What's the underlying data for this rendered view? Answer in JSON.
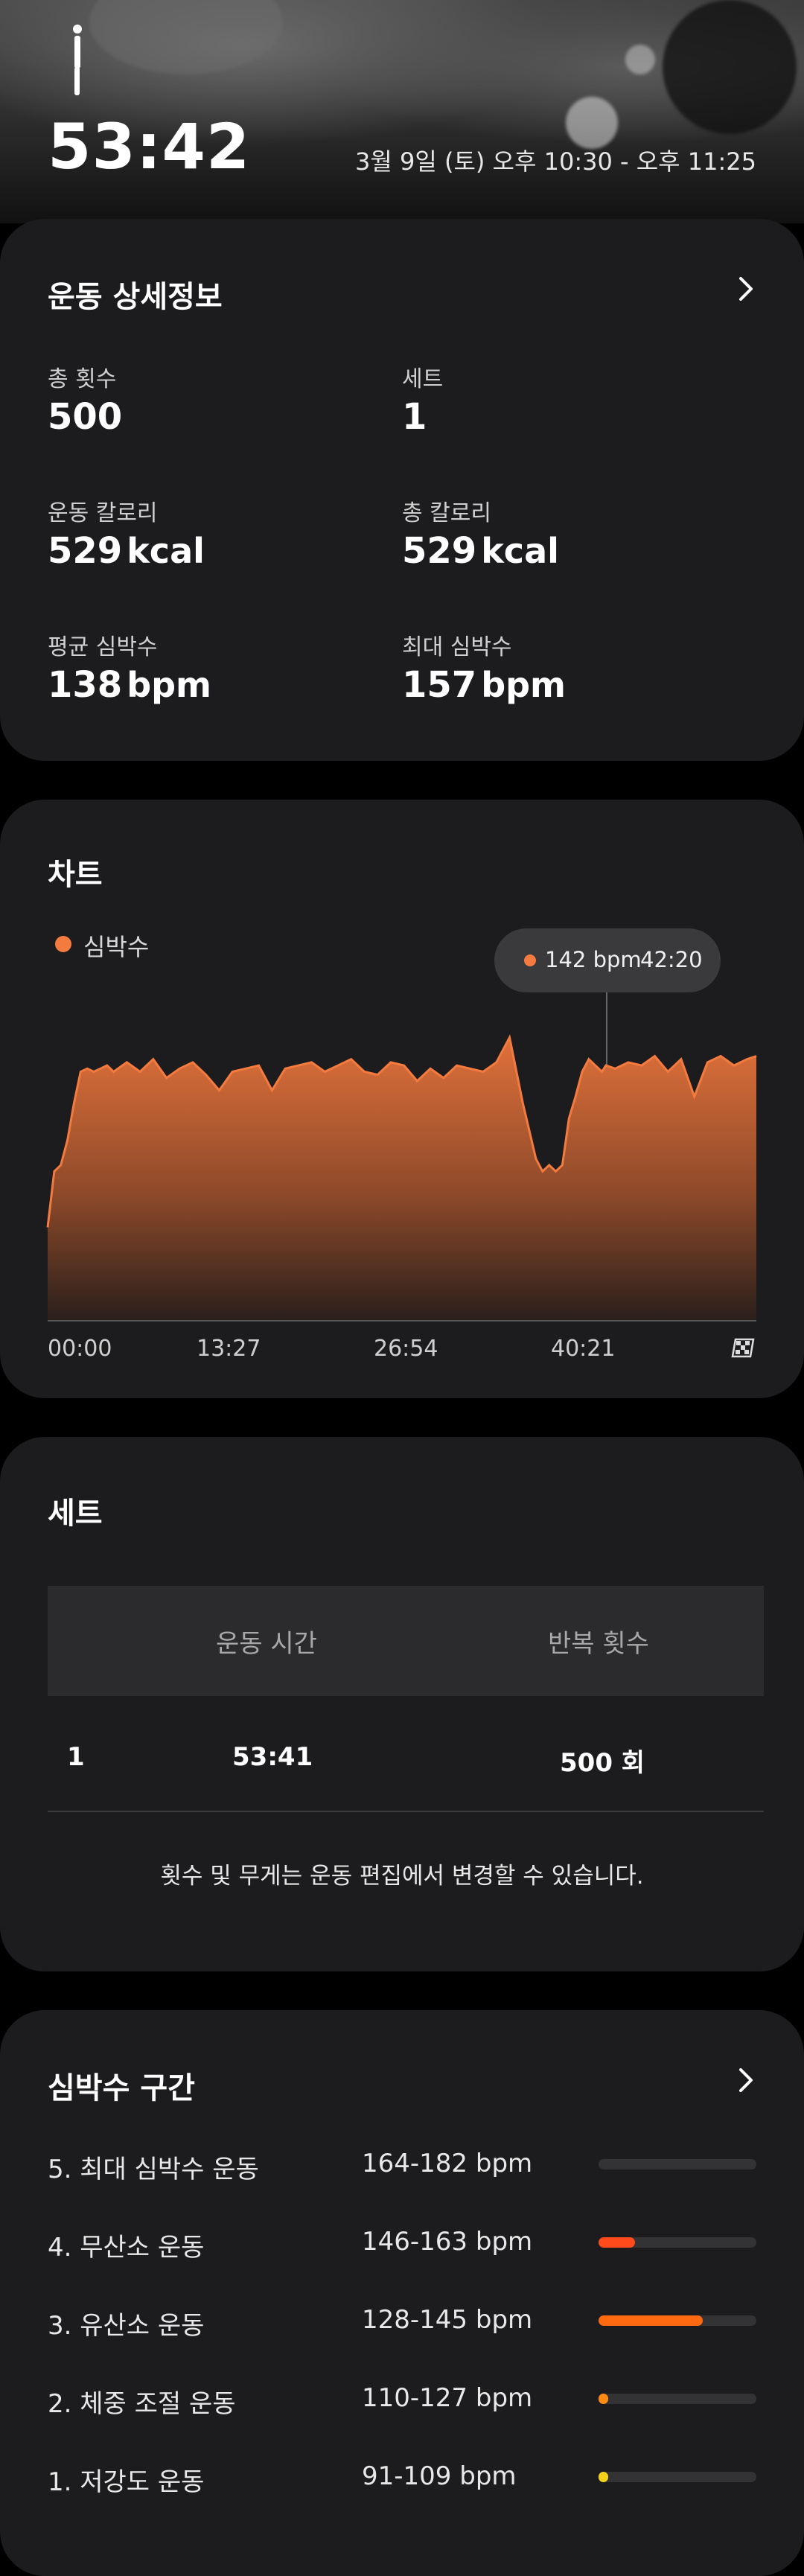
{
  "header": {
    "duration": "53:42",
    "date_range": "3월 9일 (토) 오후 10:30 - 오후 11:25",
    "icon": "standing-person-icon"
  },
  "details": {
    "title": "운동 상세정보",
    "stats": [
      {
        "label": "총 횟수",
        "value": "500",
        "unit": ""
      },
      {
        "label": "세트",
        "value": "1",
        "unit": ""
      },
      {
        "label": "운동 칼로리",
        "value": "529",
        "unit": "kcal"
      },
      {
        "label": "총 칼로리",
        "value": "529",
        "unit": "kcal"
      },
      {
        "label": "평균 심박수",
        "value": "138",
        "unit": "bpm"
      },
      {
        "label": "최대 심박수",
        "value": "157",
        "unit": "bpm"
      }
    ]
  },
  "chart_section": {
    "title": "차트",
    "legend": "심박수",
    "tooltip": {
      "value": "142 bpm",
      "time": "42:20"
    },
    "end_icon": "finish-flag-icon"
  },
  "chart_data": {
    "type": "area",
    "series": [
      {
        "name": "심박수",
        "color": "#f37b3f"
      }
    ],
    "x_ticks": [
      "00:00",
      "13:27",
      "26:54",
      "40:21"
    ],
    "x_range_minutes": [
      0,
      53.7
    ],
    "y_range_bpm": [
      60,
      170
    ],
    "x": [
      0,
      0.5,
      1,
      1.5,
      2,
      2.5,
      3,
      3.5,
      4,
      4.5,
      5,
      6,
      7,
      8,
      9,
      10,
      11,
      12,
      13,
      14,
      15,
      16,
      17,
      18,
      19,
      20,
      21,
      22,
      23,
      24,
      25,
      26,
      27,
      28,
      29,
      30,
      31,
      32,
      33,
      34,
      35,
      36,
      37,
      37.5,
      38,
      38.5,
      39,
      39.5,
      40,
      40.5,
      41,
      41.5,
      42,
      42.3,
      43,
      44,
      45,
      46,
      47,
      48,
      49,
      50,
      51,
      52,
      53,
      53.7
    ],
    "values": [
      90,
      108,
      110,
      118,
      130,
      140,
      141,
      140,
      141,
      142,
      140,
      143,
      140,
      144,
      138,
      141,
      143,
      139,
      134,
      140,
      141,
      142,
      134,
      141,
      142,
      143,
      140,
      142,
      144,
      140,
      139,
      143,
      142,
      137,
      141,
      138,
      142,
      141,
      140,
      143,
      151,
      130,
      112,
      108,
      110,
      108,
      110,
      125,
      132,
      140,
      144,
      142,
      140,
      142,
      141,
      143,
      142,
      145,
      140,
      144,
      132,
      143,
      145,
      142,
      144,
      145
    ]
  },
  "sets_section": {
    "title": "세트",
    "columns": [
      "운동 시간",
      "반복 횟수"
    ],
    "rows": [
      {
        "set": "1",
        "time": "53:41",
        "reps": "500 회"
      }
    ],
    "note": "횟수 및 무게는 운동 편집에서 변경할 수 있습니다."
  },
  "zones_section": {
    "title": "심박수 구간",
    "zones": [
      {
        "label": "5. 최대 심박수 운동",
        "range": "164-182 bpm",
        "fraction": 0.0,
        "color": "#3a3a3c"
      },
      {
        "label": "4. 무산소 운동",
        "range": "146-163 bpm",
        "fraction": 0.23,
        "color": "#ff4a1c"
      },
      {
        "label": "3. 유산소 운동",
        "range": "128-145 bpm",
        "fraction": 0.66,
        "color": "#ff6a10"
      },
      {
        "label": "2. 체중 조절 운동",
        "range": "110-127 bpm",
        "fraction": 0.06,
        "color": "#ff8a12"
      },
      {
        "label": "1. 저강도 운동",
        "range": "91-109 bpm",
        "fraction": 0.06,
        "color": "#f4d21c"
      }
    ]
  }
}
